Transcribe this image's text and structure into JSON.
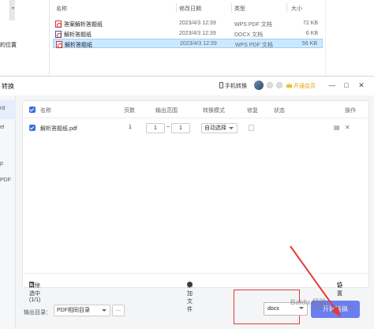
{
  "explorer": {
    "nav_text": "的位置",
    "columns": {
      "name": "名称",
      "date": "修改日期",
      "type": "类型",
      "size": "大小"
    },
    "files": [
      {
        "name": "答案解析答题纸",
        "date": "2023/4/3 12:39",
        "type": "WPS PDF 文档",
        "size": "72 KB",
        "selected": false
      },
      {
        "name": "解析答题纸",
        "date": "2023/4/3 12:39",
        "type": "DOCX 文档",
        "size": "6 KB",
        "selected": false
      },
      {
        "name": "解析答题纸",
        "date": "2023/4/3 12:39",
        "type": "WPS PDF 文档",
        "size": "56 KB",
        "selected": true
      }
    ]
  },
  "app": {
    "title": "转换",
    "phone_convert": "手机转换",
    "vip": "开通会员",
    "window_buttons": {
      "minimize": "—",
      "maximize": "□",
      "close": "✕"
    },
    "side_items": [
      "rd",
      "el",
      "p",
      "PDF"
    ],
    "table": {
      "headers": {
        "name": "名称",
        "pages": "页数",
        "range": "输出范围",
        "mode": "转换模式",
        "fix": "修复",
        "status": "状态",
        "ops": "操作"
      },
      "rows": [
        {
          "name": "解析答题纸.pdf",
          "pages": "1",
          "from": "1",
          "sep": "~",
          "to": "1",
          "mode": "自动选择",
          "status": ""
        }
      ]
    },
    "footer": {
      "clear": "清除选中(1/1)",
      "add": "添加文件",
      "settings": "设置"
    },
    "output": {
      "label": "输出目录：",
      "dir": "PDF相同目录",
      "more": "...",
      "format": "docx",
      "start": "开始转换"
    }
  },
  "watermark": {
    "main": "Baidu 经验",
    "sub": "jingyan.baidu.com"
  },
  "colors": {
    "accent": "#3b6fe0",
    "start_button": "#6c7df2",
    "highlight": "#e53935",
    "vip": "#e3a300"
  }
}
